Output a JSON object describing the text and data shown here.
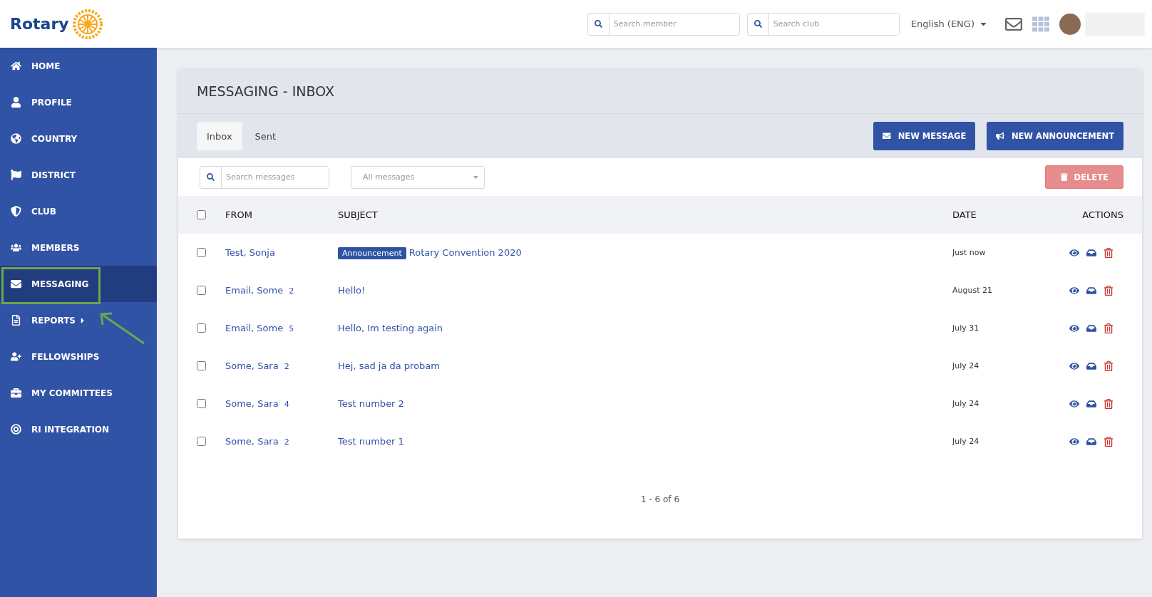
{
  "header": {
    "logo": "Rotary",
    "search_member": {
      "placeholder": "Search member"
    },
    "search_club": {
      "placeholder": "Search club"
    },
    "language": "English (ENG)"
  },
  "sidebar": {
    "items": [
      {
        "label": "HOME",
        "selected": false,
        "submenu": false
      },
      {
        "label": "PROFILE",
        "selected": false,
        "submenu": false
      },
      {
        "label": "COUNTRY",
        "selected": false,
        "submenu": false
      },
      {
        "label": "DISTRICT",
        "selected": false,
        "submenu": false
      },
      {
        "label": "CLUB",
        "selected": false,
        "submenu": false
      },
      {
        "label": "MEMBERS",
        "selected": false,
        "submenu": false
      },
      {
        "label": "MESSAGING",
        "selected": true,
        "submenu": false
      },
      {
        "label": "REPORTS",
        "selected": false,
        "submenu": true
      },
      {
        "label": "FELLOWSHIPS",
        "selected": false,
        "submenu": false
      },
      {
        "label": "MY COMMITTEES",
        "selected": false,
        "submenu": false
      },
      {
        "label": "RI INTEGRATION",
        "selected": false,
        "submenu": false
      }
    ]
  },
  "panel": {
    "title": "MESSAGING - INBOX",
    "tabs": [
      {
        "label": "Inbox",
        "selected": true
      },
      {
        "label": "Sent",
        "selected": false
      }
    ],
    "buttons": [
      {
        "label": "NEW MESSAGE"
      },
      {
        "label": "NEW ANNOUNCEMENT"
      }
    ],
    "search": {
      "placeholder": "Search messages"
    },
    "filter": {
      "value": "All messages"
    },
    "delete": {
      "label": "DELETE",
      "disabled": true
    },
    "table": {
      "columns": [
        "FROM",
        "SUBJECT",
        "DATE",
        "ACTIONS"
      ],
      "all_checked": false,
      "rows": [
        {
          "checked": false,
          "from": "Test, Sonja",
          "count": "",
          "tag": "Announcement",
          "subject": "Rotary Convention 2020",
          "date": "Just now"
        },
        {
          "checked": false,
          "from": "Email, Some",
          "count": "2",
          "tag": "",
          "subject": "Hello!",
          "date": "August 21"
        },
        {
          "checked": false,
          "from": "Email, Some",
          "count": "5",
          "tag": "",
          "subject": "Hello, Im testing again",
          "date": "July 31"
        },
        {
          "checked": false,
          "from": "Some, Sara",
          "count": "2",
          "tag": "",
          "subject": "Hej, sad ja da probam",
          "date": "July 24"
        },
        {
          "checked": false,
          "from": "Some, Sara",
          "count": "4",
          "tag": "",
          "subject": "Test number 2",
          "date": "July 24"
        },
        {
          "checked": false,
          "from": "Some, Sara",
          "count": "2",
          "tag": "",
          "subject": "Test number 1",
          "date": "July 24"
        }
      ]
    },
    "pagination": "1 - 6 of 6"
  }
}
